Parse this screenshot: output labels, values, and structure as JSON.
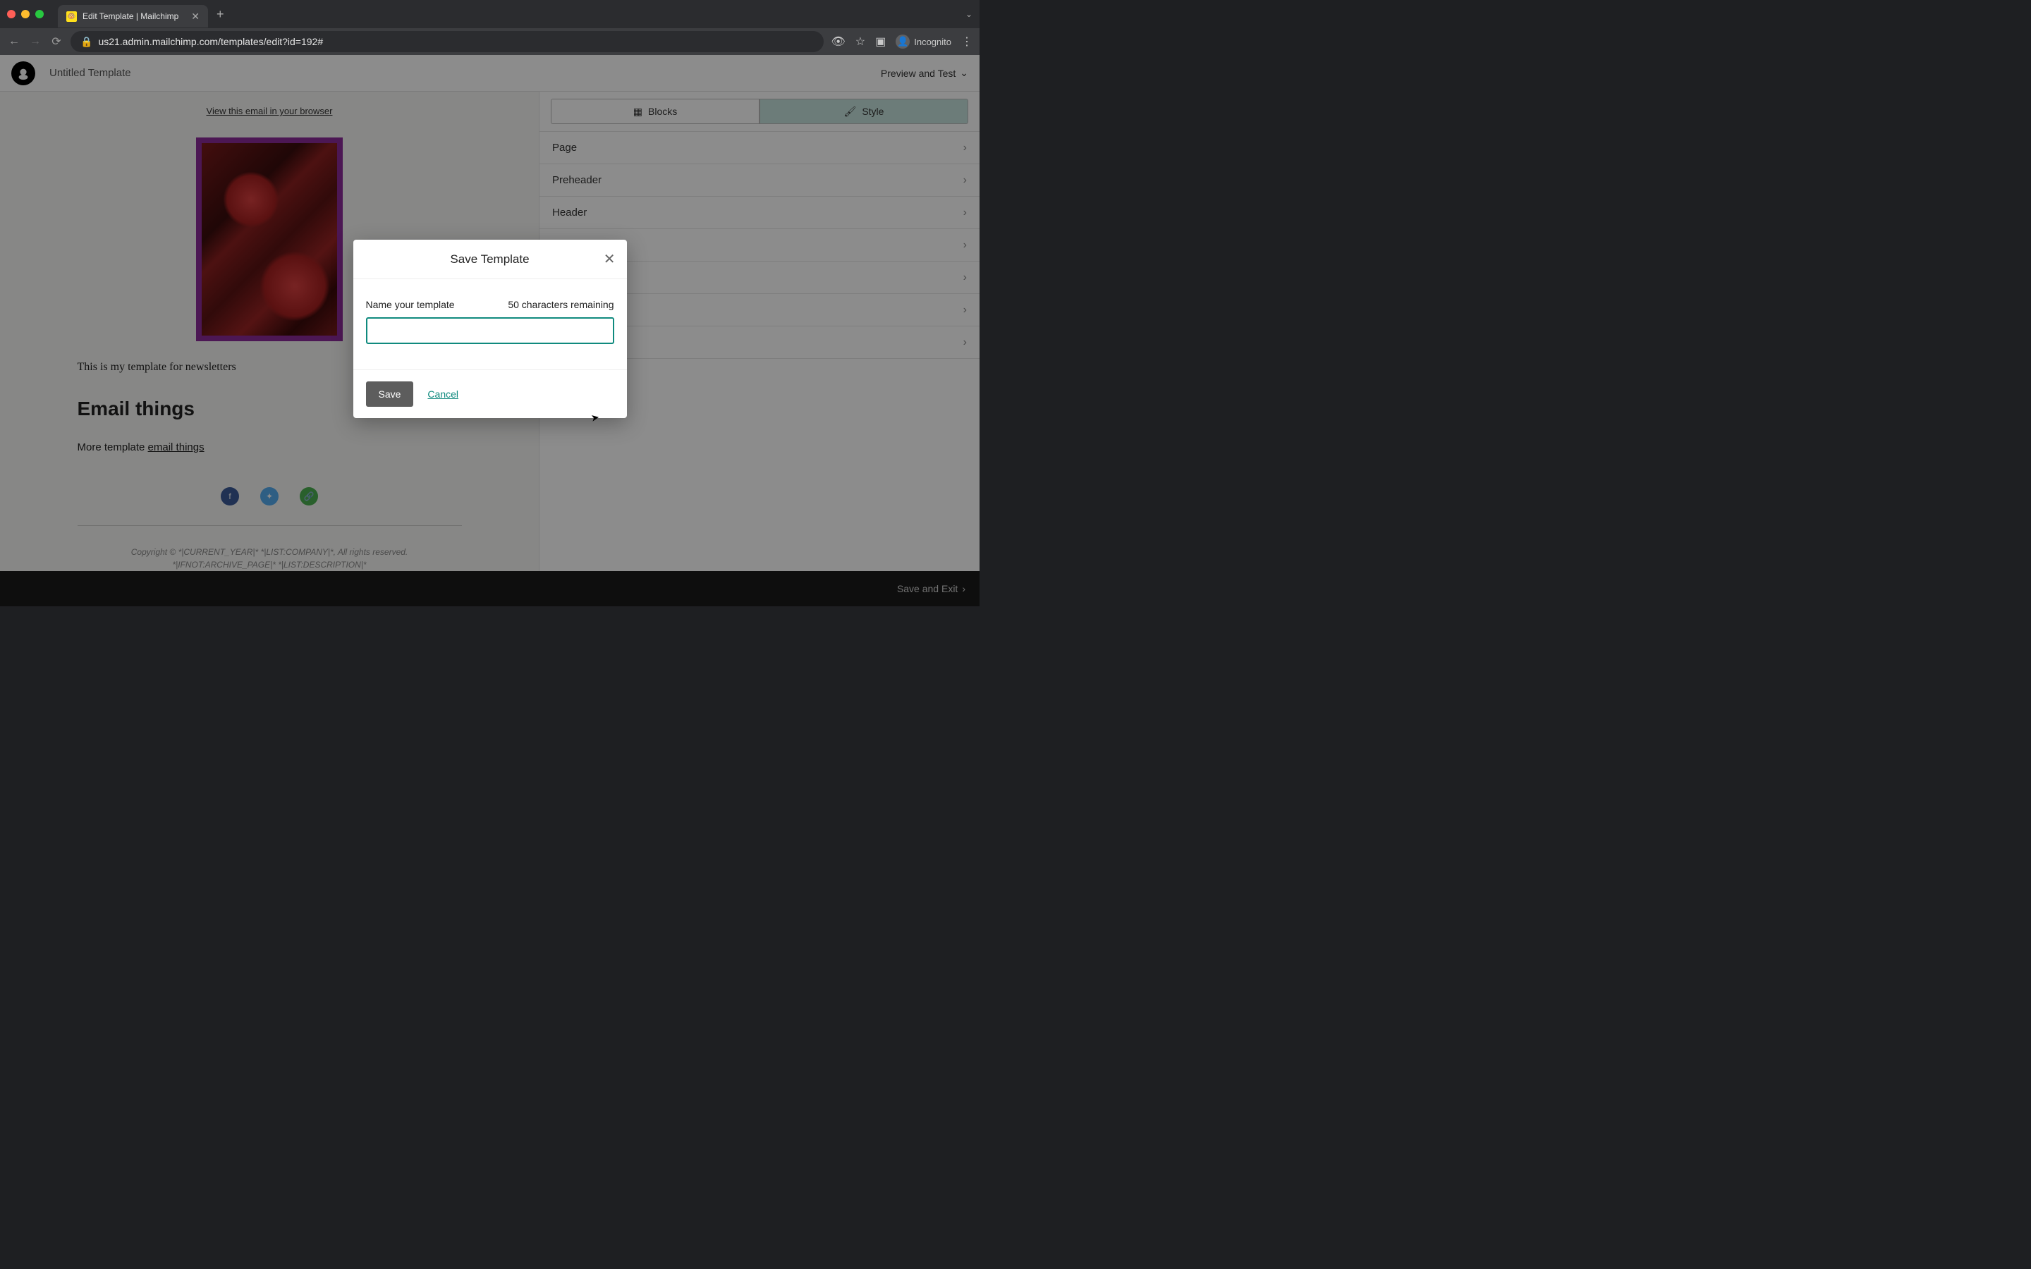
{
  "browser": {
    "tab_title": "Edit Template | Mailchimp",
    "url_full": "us21.admin.mailchimp.com/templates/edit?id=192#",
    "incognito_label": "Incognito"
  },
  "header": {
    "template_name": "Untitled Template",
    "preview_label": "Preview and Test"
  },
  "canvas": {
    "view_link": "View this email in your browser",
    "body1": "This is my template for newsletters",
    "heading": "Email things",
    "body2_prefix": "More template ",
    "body2_link": "email things",
    "copyright": "Copyright © *|CURRENT_YEAR|* *|LIST:COMPANY|*, All rights reserved.",
    "description": "*|IFNOT:ARCHIVE_PAGE|* *|LIST:DESCRIPTION|*"
  },
  "sidebar": {
    "tabs": {
      "blocks": "Blocks",
      "style": "Style"
    },
    "sections": [
      "Page",
      "Preheader",
      "Header",
      "",
      "",
      "",
      ""
    ]
  },
  "footer": {
    "save_exit": "Save and Exit"
  },
  "modal": {
    "title": "Save Template",
    "label": "Name your template",
    "char_hint": "50 characters remaining",
    "input_value": "",
    "save_label": "Save",
    "cancel_label": "Cancel"
  }
}
